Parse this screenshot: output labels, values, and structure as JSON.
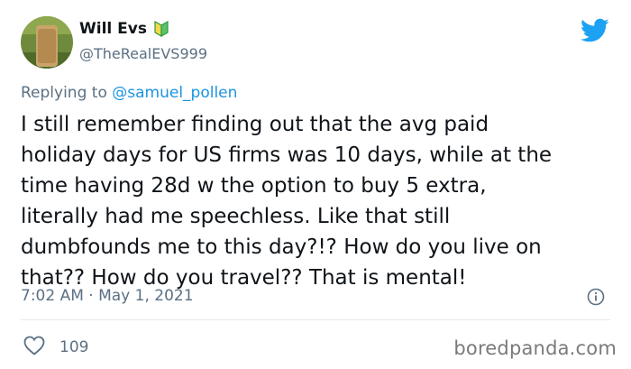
{
  "author": {
    "display_name": "Will Evs",
    "handle": "@TheRealEVS999",
    "avatar": "avatar-photo",
    "badge_icon": "beginner-badge-icon"
  },
  "platform_icon": "twitter-bird-icon",
  "reply": {
    "prefix": "Replying to",
    "mention": "@samuel_pollen"
  },
  "tweet": {
    "text": "I still remember finding out that the avg paid\nholiday days for US firms was 10 days, while at the\ntime having 28d w the option to buy 5 extra,\nliterally had me speechless. Like that still\ndumbfounds me to this day?!? How do you live on\nthat?? How do you travel?? That is mental!",
    "timestamp": "7:02 AM · May 1, 2021"
  },
  "engagement": {
    "likes": "109",
    "like_icon": "heart-icon"
  },
  "info_icon": "info-icon",
  "watermark": "boredpanda.com",
  "colors": {
    "link": "#1b95e0",
    "secondary_text": "#5b7083",
    "twitter_blue": "#1da1f2"
  }
}
